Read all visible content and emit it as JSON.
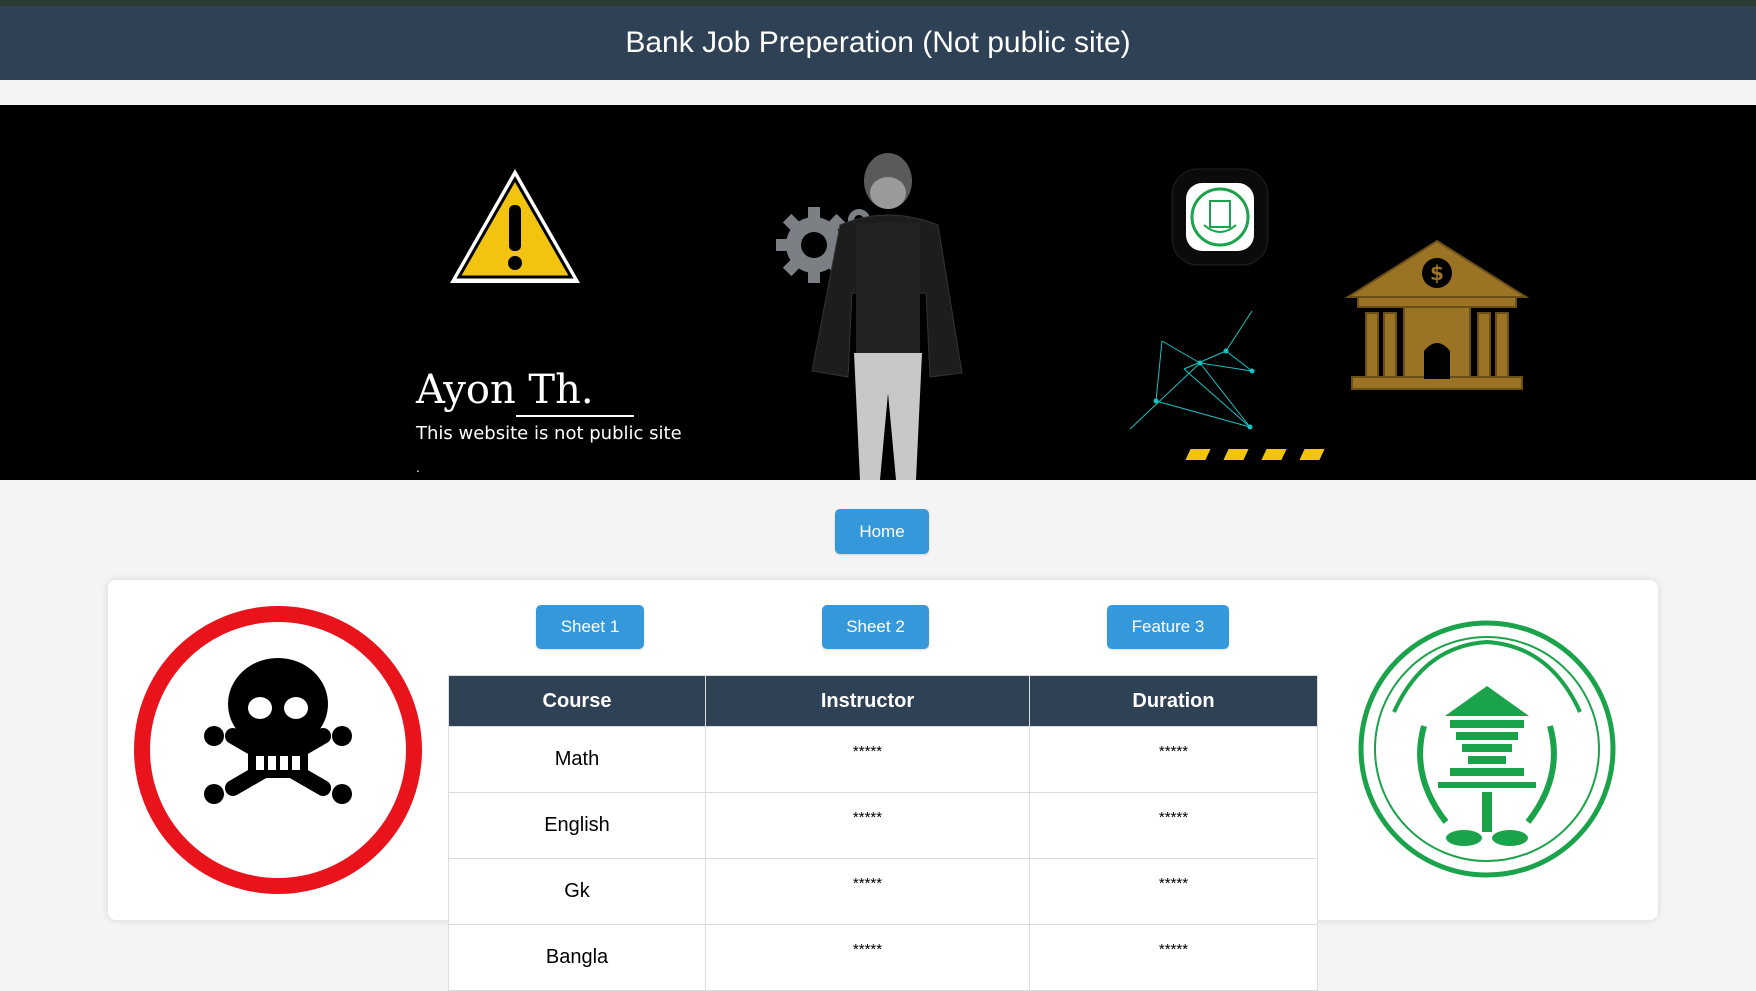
{
  "header": {
    "title": "Bank Job Preperation (Not public site)"
  },
  "banner": {
    "name": "Ayon Th.",
    "subtitle": "This website is not public site",
    "dot": "."
  },
  "nav": {
    "home_label": "Home"
  },
  "buttons": {
    "sheet1": "Sheet 1",
    "sheet2": "Sheet 2",
    "feature3": "Feature 3"
  },
  "table": {
    "headers": [
      "Course",
      "Instructor",
      "Duration"
    ],
    "rows": [
      [
        "Math",
        "*****",
        "*****"
      ],
      [
        "English",
        "*****",
        "*****"
      ],
      [
        "Gk",
        "*****",
        "*****"
      ],
      [
        "Bangla",
        "*****",
        "*****"
      ]
    ]
  },
  "icons": {
    "warning": "warning-icon",
    "gear": "gear-icon",
    "bank_logo": "bangladesh-bank-logo",
    "bank_building": "bank-building-icon",
    "danger": "skull-crossbones-icon"
  },
  "colors": {
    "header_bg": "#2f4154",
    "button_bg": "#3498db",
    "warning_yellow": "#f2c40f",
    "logo_green": "#1aa34a",
    "danger_red": "#e8131b"
  }
}
